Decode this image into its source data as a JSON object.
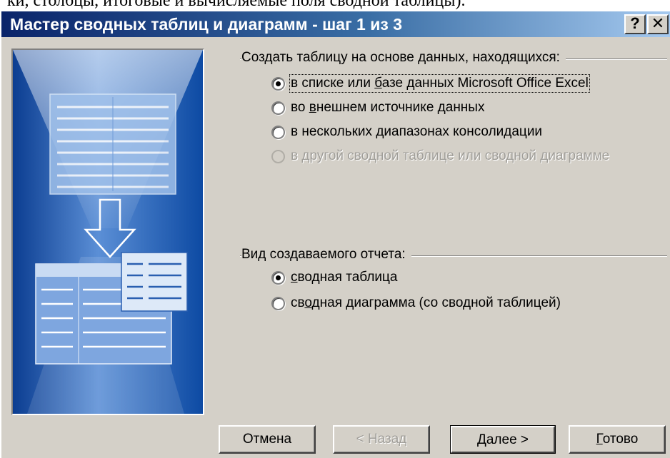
{
  "caption_fragment": "ки, столбцы, итоговые и вычисляемые поля сводной таблицы).",
  "window": {
    "title": "Мастер сводных таблиц и диаграмм - шаг 1 из 3",
    "help_label": "?",
    "close_label": "✕"
  },
  "source_group": {
    "label": "Создать таблицу на основе данных, находящихся:",
    "options": [
      {
        "pre": "в списке или ",
        "u": "б",
        "post": "азе данных Microsoft Office Excel",
        "checked": true,
        "disabled": false,
        "focused": true
      },
      {
        "pre": "во ",
        "u": "в",
        "post": "нешнем источнике данных",
        "checked": false,
        "disabled": false,
        "focused": false
      },
      {
        "pre": "в нескольких ",
        "u": "д",
        "post": "иапазонах консолидации",
        "checked": false,
        "disabled": false,
        "focused": false
      },
      {
        "pre": "в другой сводной таблице или сводной диаграмме",
        "u": "",
        "post": "",
        "checked": false,
        "disabled": true,
        "focused": false
      }
    ]
  },
  "report_group": {
    "label": "Вид создаваемого отчета:",
    "options": [
      {
        "pre": "",
        "u": "с",
        "post": "водная таблица",
        "checked": true,
        "disabled": false,
        "focused": false
      },
      {
        "pre": "св",
        "u": "о",
        "post": "дная диаграмма (со сводной таблицей)",
        "checked": false,
        "disabled": false,
        "focused": false
      }
    ]
  },
  "buttons": {
    "cancel": "Отмена",
    "back": "< Назад",
    "next_pre": "",
    "next_u": "Д",
    "next_post": "алее >",
    "finish_pre": "",
    "finish_u": "Г",
    "finish_post": "отово"
  },
  "colors": {
    "dialog_face": "#d4d0c8",
    "title_gradient_start": "#0a246a",
    "title_gradient_end": "#a6caf0",
    "illustration_blue": "#1a55a8"
  }
}
